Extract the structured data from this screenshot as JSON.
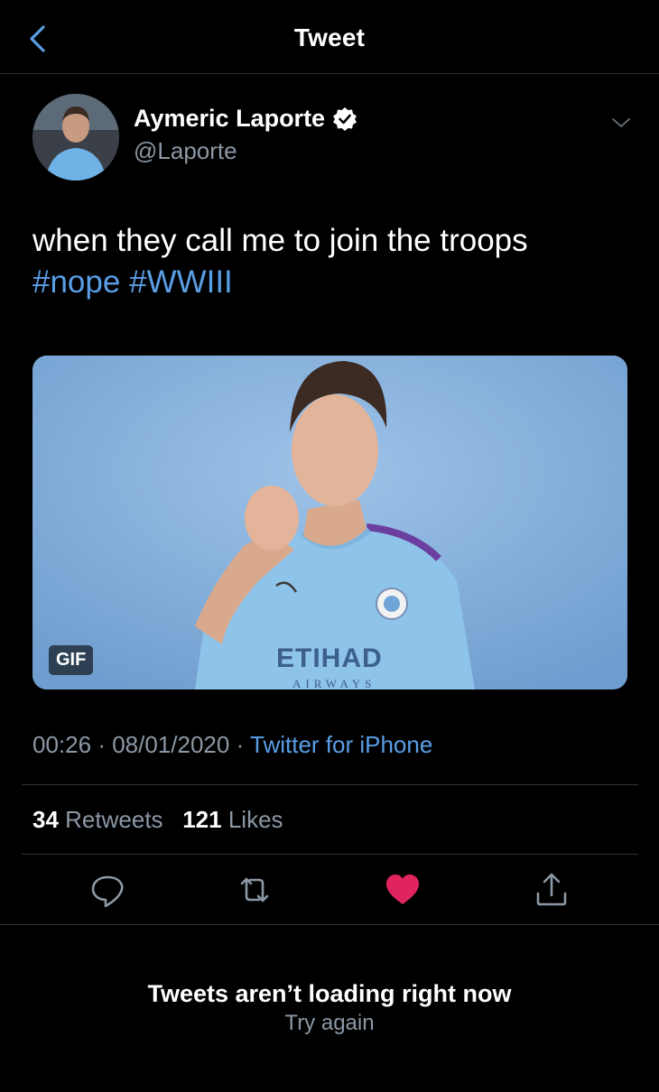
{
  "header": {
    "title": "Tweet"
  },
  "tweet": {
    "author": {
      "display_name": "Aymeric Laporte",
      "handle": "@Laporte",
      "verified": true
    },
    "text": "when they call me to join the troops",
    "hashtags": [
      "#nope",
      "#WWIII"
    ],
    "media": {
      "type_badge": "GIF",
      "jersey_text": "ETIHAD",
      "jersey_subtext": "AIRWAYS"
    },
    "time": "00:26",
    "date": "08/01/2020",
    "source": "Twitter for iPhone",
    "retweets_count": "34",
    "retweets_label": "Retweets",
    "likes_count": "121",
    "likes_label": "Likes"
  },
  "actions": [
    {
      "name": "reply",
      "icon": "speech-bubble-icon"
    },
    {
      "name": "retweet",
      "icon": "retweet-icon"
    },
    {
      "name": "like",
      "icon": "heart-icon",
      "active": true
    },
    {
      "name": "share",
      "icon": "share-icon"
    }
  ],
  "colors": {
    "accent": "#5a9ee6",
    "like": "#e0245e",
    "muted": "#8b98a5",
    "background": "#000000"
  },
  "error": {
    "title": "Tweets aren’t loading right now",
    "retry": "Try again"
  }
}
